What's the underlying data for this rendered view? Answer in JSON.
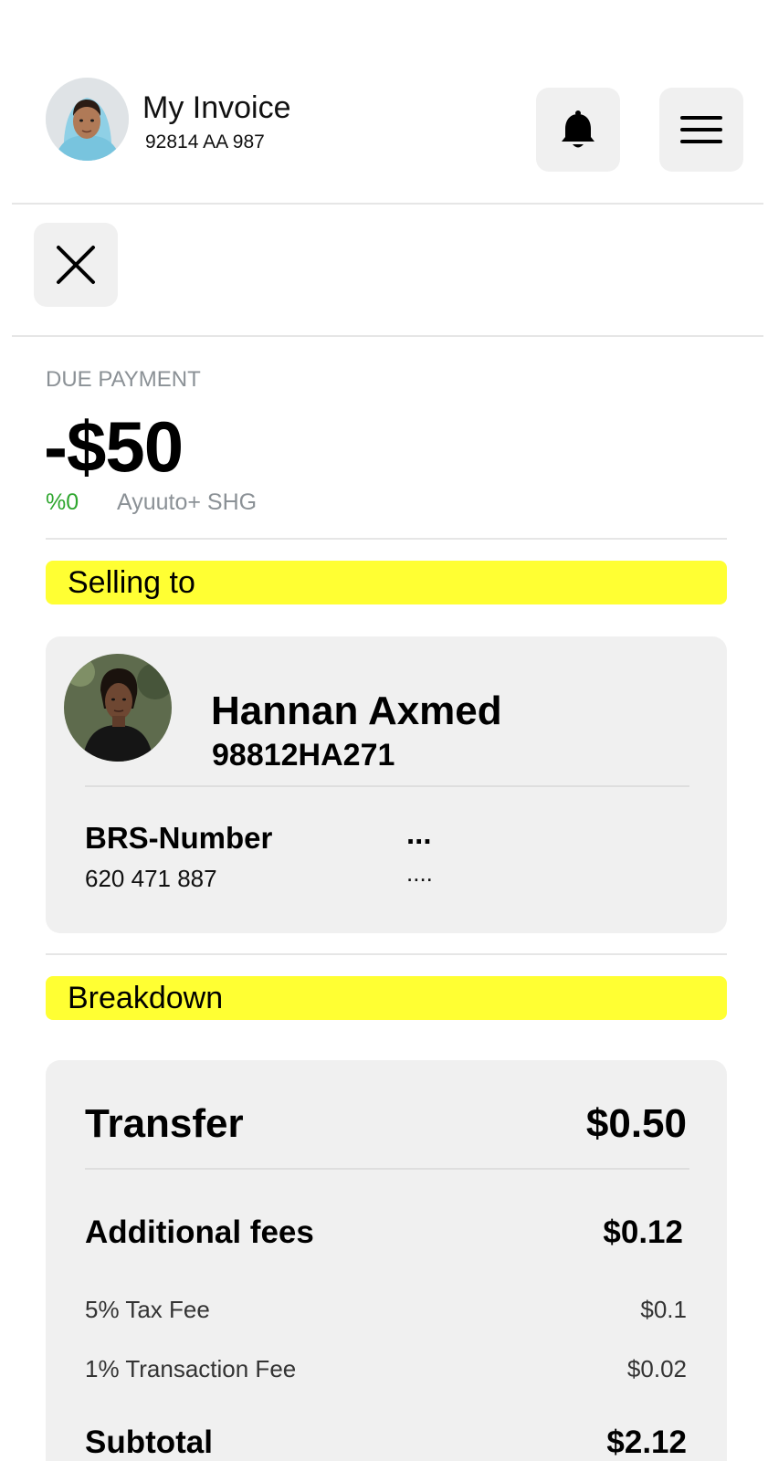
{
  "header": {
    "title": "My Invoice",
    "account_id": "92814 AA 987",
    "avatar_icon": "user-avatar",
    "notification_icon": "bell-icon",
    "menu_icon": "menu-icon"
  },
  "toolbar": {
    "close_icon": "close-icon"
  },
  "due": {
    "label": "DUE PAYMENT",
    "amount": "-$50",
    "percent": "%0",
    "group": "Ayuuto+ SHG"
  },
  "sections": {
    "selling_to": "Selling to",
    "breakdown": "Breakdown"
  },
  "seller": {
    "name": "Hannan Axmed",
    "id": "98812HA271",
    "brs_label": "BRS-Number",
    "brs_value": "620 471 887",
    "extra_label": "...",
    "extra_value": "...."
  },
  "breakdown": {
    "transfer_label": "Transfer",
    "transfer_value": "$0.50",
    "fees_label": "Additional fees",
    "fees_value": "$0.12",
    "tax_label": "5% Tax Fee",
    "tax_value": "$0.1",
    "transaction_label": "1% Transaction Fee",
    "transaction_value": "$0.02",
    "subtotal_label": "Subtotal",
    "subtotal_value": "$2.12"
  },
  "colors": {
    "highlight": "#ffff33",
    "positive": "#2ea62e",
    "muted_text": "#8b9196",
    "card_bg": "#f0f0f0"
  }
}
